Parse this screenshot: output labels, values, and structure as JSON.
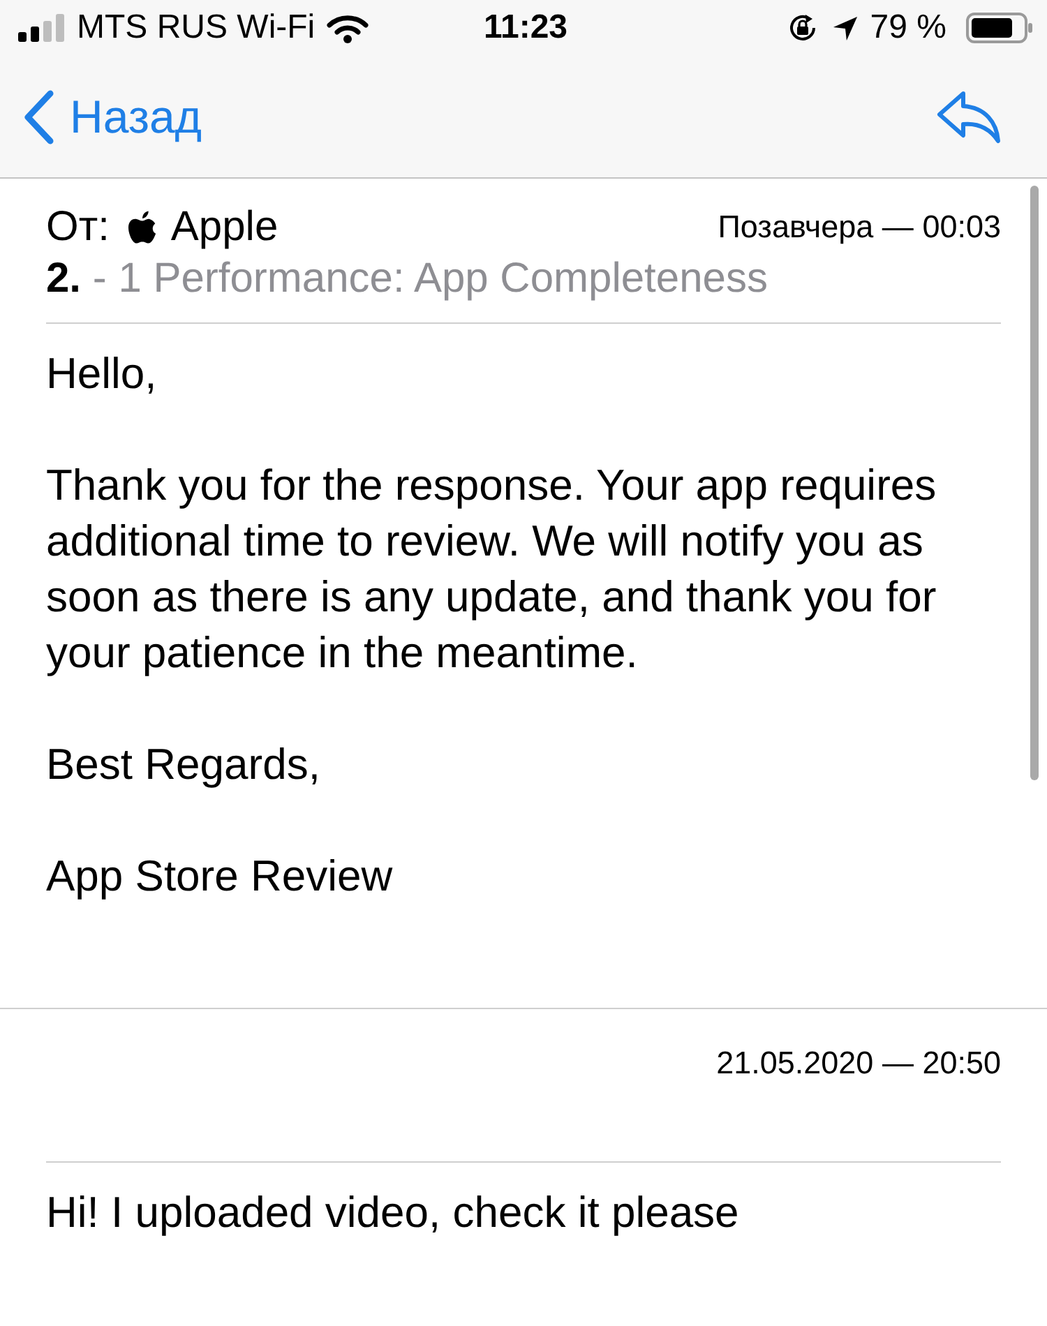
{
  "status_bar": {
    "carrier": "MTS RUS Wi-Fi",
    "time": "11:23",
    "battery": "79 %"
  },
  "nav_bar": {
    "back_label": "Назад"
  },
  "messages": [
    {
      "from_label": "От:",
      "sender": "Apple",
      "date": "Позавчера — 00:03",
      "subject": "**2.** - 1 Performance: App Completeness",
      "body": [
        "Hello,",
        "Thank you for the response. Your app requires additional time to review. We will notify you as soon as there is any update, and thank you for your patience in the meantime.",
        "Best Regards,",
        "App Store Review"
      ]
    },
    {
      "date": "21.05.2020 — 20:50",
      "body": [
        "Hi! I uploaded video, check it please"
      ]
    }
  ]
}
